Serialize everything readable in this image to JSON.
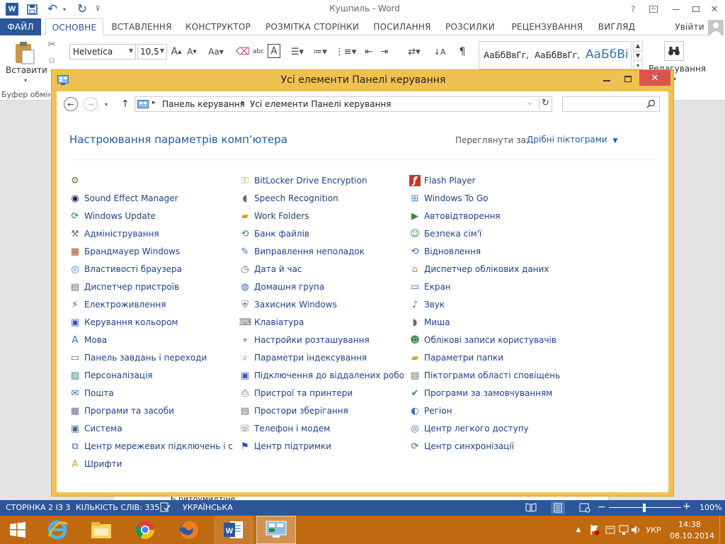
{
  "word": {
    "title": "Кушпиль - Word",
    "help_label": "?",
    "user_label": "Увійти",
    "tabs": [
      {
        "label": "ФАЙЛ"
      },
      {
        "label": "ОСНОВНЕ"
      },
      {
        "label": "ВСТАВЛЕННЯ"
      },
      {
        "label": "КОНСТРУКТОР"
      },
      {
        "label": "РОЗМІТКА СТОРІНКИ"
      },
      {
        "label": "ПОСИЛАННЯ"
      },
      {
        "label": "РОЗСИЛКИ"
      },
      {
        "label": "РЕЦЕНЗУВАННЯ"
      },
      {
        "label": "ВИГЛЯД"
      }
    ],
    "ribbon": {
      "paste_label": "Вставити",
      "clipboard_group": "Буфер обмін",
      "font_name": "Helvetica",
      "font_size": "10,5",
      "styles": [
        "АаБбВвГг,",
        "АаБбВвГг,",
        "АаБбВі"
      ],
      "editing_label": "Редагування"
    },
    "doc_text": "Б ритоумидтіне"
  },
  "status": {
    "page": "СТОРІНКА 2 ІЗ 3",
    "words": "КІЛЬКІСТЬ СЛІВ: 335",
    "language": "УКРАЇНСЬКА",
    "zoom": "100%"
  },
  "cp": {
    "window_title": "Усі елементи Панелі керування",
    "breadcrumb": [
      "Панель керування",
      "Усі елементи Панелі керування"
    ],
    "search_placeholder": "",
    "heading": "Настроювання параметрів комп’ютера",
    "view_label": "Переглянути за:",
    "view_value": "Дрібні піктограми",
    "columns": [
      [
        {
          "label": "",
          "icon": "gear-icon",
          "color": "#6a7a3a"
        },
        {
          "label": "Sound Effect Manager",
          "icon": "speaker-icon",
          "color": "#1a1a6a"
        },
        {
          "label": "Windows Update",
          "icon": "windows-update-icon",
          "color": "#2e8b3e"
        },
        {
          "label": "Адміністрування",
          "icon": "admin-tools-icon",
          "color": "#6a6a8a"
        },
        {
          "label": "Брандмауер Windows",
          "icon": "firewall-icon",
          "color": "#a0522d"
        },
        {
          "label": "Властивості браузера",
          "icon": "browser-options-icon",
          "color": "#3a7ab8"
        },
        {
          "label": "Диспетчер пристроїв",
          "icon": "device-manager-icon",
          "color": "#6a6a6a"
        },
        {
          "label": "Електроживлення",
          "icon": "power-icon",
          "color": "#2e8b3e"
        },
        {
          "label": "Керування кольором",
          "icon": "color-management-icon",
          "color": "#3a5ab8"
        },
        {
          "label": "Мова",
          "icon": "language-icon",
          "color": "#2e6ab8"
        },
        {
          "label": "Панель завдань і переходи",
          "icon": "taskbar-icon",
          "color": "#4a6a9a"
        },
        {
          "label": "Персоналізація",
          "icon": "personalization-icon",
          "color": "#2e8b8b"
        },
        {
          "label": "Пошта",
          "icon": "mail-icon",
          "color": "#3a6ab8"
        },
        {
          "label": "Програми та засоби",
          "icon": "programs-icon",
          "color": "#6a6a8a"
        },
        {
          "label": "Система",
          "icon": "system-icon",
          "color": "#4a6a9a"
        },
        {
          "label": "Центр мережевих підключень і спі...",
          "icon": "network-icon",
          "color": "#3a5ab8"
        },
        {
          "label": "Шрифти",
          "icon": "fonts-icon",
          "color": "#d4a020"
        }
      ],
      [
        {
          "label": "BitLocker Drive Encryption",
          "icon": "bitlocker-icon",
          "color": "#b8a040"
        },
        {
          "label": "Speech Recognition",
          "icon": "microphone-icon",
          "color": "#6a6a6a"
        },
        {
          "label": "Work Folders",
          "icon": "work-folders-icon",
          "color": "#d4a020"
        },
        {
          "label": "Банк файлів",
          "icon": "file-history-icon",
          "color": "#2e8b3e"
        },
        {
          "label": "Виправлення неполадок",
          "icon": "troubleshooting-icon",
          "color": "#3a6ab8"
        },
        {
          "label": "Дата й час",
          "icon": "clock-icon",
          "color": "#6a6a8a"
        },
        {
          "label": "Домашня група",
          "icon": "homegroup-icon",
          "color": "#2e6ab8"
        },
        {
          "label": "Захисник Windows",
          "icon": "defender-icon",
          "color": "#6a6a6a"
        },
        {
          "label": "Клавіатура",
          "icon": "keyboard-icon",
          "color": "#6a6a6a"
        },
        {
          "label": "Настройки розташування",
          "icon": "location-icon",
          "color": "#6a6a6a"
        },
        {
          "label": "Параметри індексування",
          "icon": "indexing-icon",
          "color": "#6a6a8a"
        },
        {
          "label": "Підключення до віддалених робоч...",
          "icon": "remote-desktop-icon",
          "color": "#3a5ab8"
        },
        {
          "label": "Пристрої та принтери",
          "icon": "printer-icon",
          "color": "#6a6a6a"
        },
        {
          "label": "Простори зберігання",
          "icon": "storage-icon",
          "color": "#6a6a6a"
        },
        {
          "label": "Телефон і модем",
          "icon": "phone-icon",
          "color": "#6a6a6a"
        },
        {
          "label": "Центр підтримки",
          "icon": "flag-icon",
          "color": "#2e4ab8"
        }
      ],
      [
        {
          "label": "Flash Player",
          "icon": "flash-icon",
          "color": "#c0392b"
        },
        {
          "label": "Windows To Go",
          "icon": "windows-to-go-icon",
          "color": "#3a8ad8"
        },
        {
          "label": "Автовідтворення",
          "icon": "autoplay-icon",
          "color": "#2e8b3e"
        },
        {
          "label": "Безпека сім'ї",
          "icon": "family-safety-icon",
          "color": "#2e8b3e"
        },
        {
          "label": "Відновлення",
          "icon": "recovery-icon",
          "color": "#3a6ab8"
        },
        {
          "label": "Диспетчер облікових даних",
          "icon": "credential-manager-icon",
          "color": "#b8902e"
        },
        {
          "label": "Екран",
          "icon": "display-icon",
          "color": "#2e6ab8"
        },
        {
          "label": "Звук",
          "icon": "sound-icon",
          "color": "#6a6a6a"
        },
        {
          "label": "Миша",
          "icon": "mouse-icon",
          "color": "#6a6a6a"
        },
        {
          "label": "Облікові записи користувачів",
          "icon": "user-accounts-icon",
          "color": "#3a8a4a"
        },
        {
          "label": "Параметри папки",
          "icon": "folder-options-icon",
          "color": "#d4a020"
        },
        {
          "label": "Піктограми області сповіщень",
          "icon": "notification-icons-icon",
          "color": "#6a6a6a"
        },
        {
          "label": "Програми за замовчуванням",
          "icon": "default-programs-icon",
          "color": "#2e8b3e"
        },
        {
          "label": "Регіон",
          "icon": "region-icon",
          "color": "#3a6ab8"
        },
        {
          "label": "Центр легкого доступу",
          "icon": "ease-of-access-icon",
          "color": "#3a6ab8"
        },
        {
          "label": "Центр синхронізації",
          "icon": "sync-center-icon",
          "color": "#2e8b3e"
        }
      ]
    ]
  },
  "taskbar": {
    "language": "УКР",
    "time": "14:38",
    "date": "08.10.2014"
  },
  "colors": {
    "word_blue": "#2b579a",
    "link_blue": "#1e3f8f",
    "heading_blue": "#1e5aa0",
    "cp_border": "#f0c050",
    "taskbar": "#c06a10",
    "close_red": "#d9534f"
  }
}
